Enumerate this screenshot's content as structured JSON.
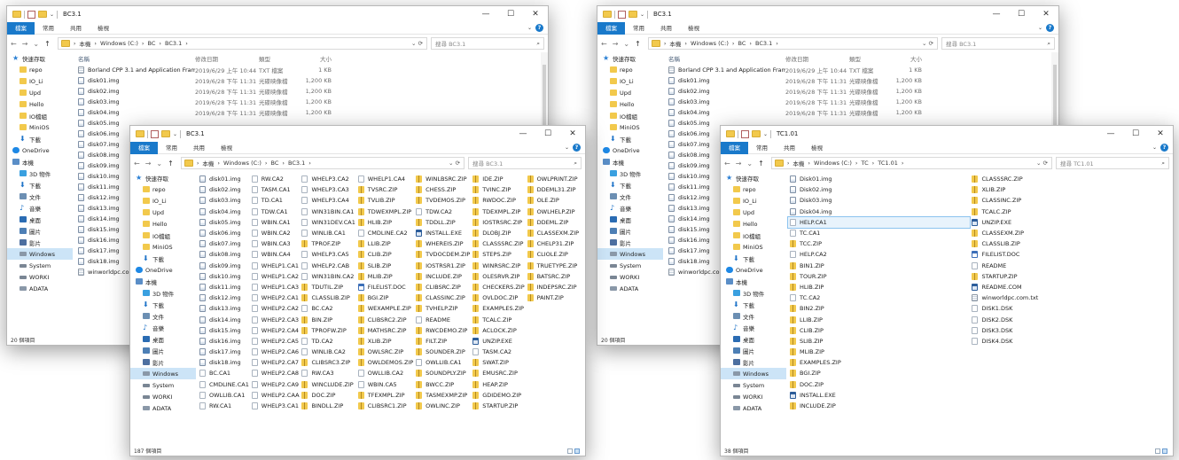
{
  "ui": {
    "tabs": [
      "檔案",
      "常用",
      "共用",
      "檢視"
    ],
    "nav_back": "←",
    "nav_fwd": "→",
    "nav_recent": "⌄",
    "nav_up": "↑",
    "minimize": "—",
    "maximize": "☐",
    "close": "✕",
    "refresh": "⟳",
    "dropdown": "⌄",
    "search_icon": "⌕",
    "help": "?",
    "ribbon_toggle": "⌄",
    "addr_sep": "›"
  },
  "nav_tree_full": [
    {
      "label": "快速存取",
      "icon": "star-icon",
      "indent": false
    },
    {
      "label": "repo",
      "icon": "folder-icon",
      "indent": true
    },
    {
      "label": "IO_Li",
      "icon": "folder-icon",
      "indent": true
    },
    {
      "label": "Upd",
      "icon": "folder-icon",
      "indent": true
    },
    {
      "label": "Hello",
      "icon": "folder-icon",
      "indent": true
    },
    {
      "label": "IO檔組",
      "icon": "folder-icon",
      "indent": true
    },
    {
      "label": "MiniOS",
      "icon": "folder-icon",
      "indent": true
    },
    {
      "label": "下載",
      "icon": "download-icon",
      "indent": true
    },
    {
      "label": "OneDrive",
      "icon": "cloud-icon",
      "indent": false
    },
    {
      "label": "本機",
      "icon": "pc-icon",
      "indent": false
    },
    {
      "label": "3D 物件",
      "icon": "objects-icon",
      "indent": true
    },
    {
      "label": "下載",
      "icon": "download-icon",
      "indent": true
    },
    {
      "label": "文件",
      "icon": "documents-icon",
      "indent": true
    },
    {
      "label": "音樂",
      "icon": "music-icon",
      "indent": true
    },
    {
      "label": "桌面",
      "icon": "desktop-icon",
      "indent": true
    },
    {
      "label": "圖片",
      "icon": "pictures-icon",
      "indent": true
    },
    {
      "label": "影片",
      "icon": "videos-icon",
      "indent": true
    },
    {
      "label": "Windows",
      "icon": "drive-icon",
      "indent": true,
      "selected": true
    },
    {
      "label": "System",
      "icon": "system-drive-icon",
      "indent": true
    },
    {
      "label": "WORKI",
      "icon": "system-drive-icon",
      "indent": true
    },
    {
      "label": "ADATA",
      "icon": "drive-icon",
      "indent": true
    }
  ],
  "headers": {
    "name": "名稱",
    "date": "修改日期",
    "type": "類型",
    "size": "大小"
  },
  "win1": {
    "title": "BC3.1",
    "address": [
      "本機",
      "Windows (C:)",
      "BC",
      "BC3.1"
    ],
    "search": "搜尋 BC3.1",
    "status": "20 個項目",
    "rows": [
      {
        "name": "Borland CPP 3.1 and Application Fram...",
        "date": "2019/6/29 上午 10:44",
        "type": "TXT 檔案",
        "size": "1 KB",
        "icon": "txt"
      },
      {
        "name": "disk01.img",
        "date": "2019/6/28 下午 11:31",
        "type": "光碟映像檔",
        "size": "1,200 KB",
        "icon": "img"
      },
      {
        "name": "disk02.img",
        "date": "2019/6/28 下午 11:31",
        "type": "光碟映像檔",
        "size": "1,200 KB",
        "icon": "img"
      },
      {
        "name": "disk03.img",
        "date": "2019/6/28 下午 11:31",
        "type": "光碟映像檔",
        "size": "1,200 KB",
        "icon": "img"
      },
      {
        "name": "disk04.img",
        "date": "2019/6/28 下午 11:31",
        "type": "光碟映像檔",
        "size": "1,200 KB",
        "icon": "img"
      },
      {
        "name": "disk05.img",
        "icon": "img"
      },
      {
        "name": "disk06.img",
        "icon": "img"
      },
      {
        "name": "disk07.img",
        "icon": "img"
      },
      {
        "name": "disk08.img",
        "icon": "img"
      },
      {
        "name": "disk09.img",
        "icon": "img"
      },
      {
        "name": "disk10.img",
        "icon": "img"
      },
      {
        "name": "disk11.img",
        "icon": "img"
      },
      {
        "name": "disk12.img",
        "icon": "img"
      },
      {
        "name": "disk13.img",
        "icon": "img"
      },
      {
        "name": "disk14.img",
        "icon": "img"
      },
      {
        "name": "disk15.img",
        "icon": "img"
      },
      {
        "name": "disk16.img",
        "icon": "img"
      },
      {
        "name": "disk17.img",
        "icon": "img"
      },
      {
        "name": "disk18.img",
        "icon": "img"
      },
      {
        "name": "winworldpc.com",
        "icon": "txt"
      }
    ]
  },
  "win2": {
    "title": "BC3.1",
    "address": [
      "本機",
      "Windows (C:)",
      "BC",
      "BC3.1"
    ],
    "search": "搜尋 BC3.1",
    "status": "187 個項目",
    "files": [
      "disk01.img",
      "disk02.img",
      "disk03.img",
      "disk04.img",
      "disk05.img",
      "disk06.img",
      "disk07.img",
      "disk08.img",
      "disk09.img",
      "disk10.img",
      "disk11.img",
      "disk12.img",
      "disk13.img",
      "disk14.img",
      "disk15.img",
      "disk16.img",
      "disk17.img",
      "disk18.img",
      "BC.CA1",
      "CMDLINE.CA1",
      "OWLLIB.CA1",
      "RW.CA1",
      "RW.CA2",
      "TASM.CA1",
      "TD.CA1",
      "TDW.CA1",
      "WBIN.CA1",
      "WBIN.CA2",
      "WBIN.CA3",
      "WBIN.CA4",
      "WHELP1.CA1",
      "WHELP1.CA2",
      "WHELP1.CA3",
      "WHELP2.CA1",
      "WHELP2.CA2",
      "WHELP2.CA3",
      "WHELP2.CA4",
      "WHELP2.CA5",
      "WHELP2.CA6",
      "WHELP2.CA7",
      "WHELP2.CA8",
      "WHELP2.CA9",
      "WHELP2.CAA",
      "WHELP3.CA1",
      "WHELP3.CA2",
      "WHELP3.CA3",
      "WHELP3.CA4",
      "WIN31BIN.CA1",
      "WIN31DEV.CA1",
      "WINLIB.CA1",
      "TPROF.ZIP",
      "WHELP3.CA5",
      "WHELP2.CAB",
      "WIN31BIN.CA2",
      "TDUTIL.ZIP",
      "CLASSLIB.ZIP",
      "BC.CA2",
      "BIN.ZIP",
      "TPROFW.ZIP",
      "TD.CA2",
      "WINLIB.CA2",
      "CLIBSRC3.ZIP",
      "RW.CA3",
      "WINCLUDE.ZIP",
      "DOC.ZIP",
      "BINDLL.ZIP",
      "WHELP1.CA4",
      "TVSRC.ZIP",
      "TVLIB.ZIP",
      "TDWEXMPL.ZIP",
      "HLIB.ZIP",
      "CMDLINE.CA2",
      "LLIB.ZIP",
      "CLIB.ZIP",
      "SLIB.ZIP",
      "MLIB.ZIP",
      "FILELIST.DOC",
      "BGI.ZIP",
      "WEXAMPLE.ZIP",
      "CLIBSRC2.ZIP",
      "MATHSRC.ZIP",
      "XLIB.ZIP",
      "OWLSRC.ZIP",
      "OWLDEMOS.ZIP",
      "OWLLIB.CA2",
      "WBIN.CA5",
      "TFEXMPL.ZIP",
      "CLIBSRC1.ZIP",
      "WINLBSRC.ZIP",
      "CHESS.ZIP",
      "TVDEMOS.ZIP",
      "TDW.CA2",
      "TDDLL.ZIP",
      "INSTALL.EXE",
      "WHEREIS.ZIP",
      "TVDOCDEM.ZIP",
      "IOSTRSR1.ZIP",
      "INCLUDE.ZIP",
      "CLIBSRC.ZIP",
      "CLASSINC.ZIP",
      "TVHELP.ZIP",
      "README",
      "RWCDEMO.ZIP",
      "FILT.ZIP",
      "SOUNDER.ZIP",
      "OWLLIB.CA1",
      "SOUNDPLY.ZIP",
      "BWCC.ZIP",
      "TASMEXMP.ZIP",
      "OWLINC.ZIP",
      "IDE.ZIP",
      "TVINC.ZIP",
      "RWDOC.ZIP",
      "TDEXMPL.ZIP",
      "IOSTRSRC.ZIP",
      "DLOBJ.ZIP",
      "CLASSSRC.ZIP",
      "STEPS.ZIP",
      "WINRSRC.ZIP",
      "OLESRVR.ZIP",
      "CHECKERS.ZIP",
      "OVLDOC.ZIP",
      "EXAMPLES.ZIP",
      "TCALC.ZIP",
      "ACLOCK.ZIP",
      "UNZIP.EXE",
      "TASM.CA2",
      "SWAT.ZIP",
      "EMUSRC.ZIP",
      "HEAP.ZIP",
      "GDIDEMO.ZIP",
      "STARTUP.ZIP",
      "OWLPRINT.ZIP",
      "DDEML31.ZIP",
      "OLE.ZIP",
      "OWLHELP.ZIP",
      "DDEML.ZIP",
      "CLASSEXM.ZIP",
      "CHELP31.ZIP",
      "CLIOLE.ZIP",
      "TRUETYPE.ZIP",
      "BATSRC.ZIP",
      "INDEPSRC.ZIP",
      "PAINT.ZIP"
    ]
  },
  "win3": {
    "title": "BC3.1",
    "address": [
      "本機",
      "Windows (C:)",
      "BC",
      "BC3.1"
    ],
    "search": "搜尋 BC3.1",
    "status": "20 個項目",
    "rows": [
      {
        "name": "Borland CPP 3.1 and Application Fram...",
        "date": "2019/6/29 上午 10:44",
        "type": "TXT 檔案",
        "size": "1 KB",
        "icon": "txt"
      },
      {
        "name": "disk01.img",
        "date": "2019/6/28 下午 11:31",
        "type": "光碟映像檔",
        "size": "1,200 KB",
        "icon": "img"
      },
      {
        "name": "disk02.img",
        "date": "2019/6/28 下午 11:31",
        "type": "光碟映像檔",
        "size": "1,200 KB",
        "icon": "img"
      },
      {
        "name": "disk03.img",
        "date": "2019/6/28 下午 11:31",
        "type": "光碟映像檔",
        "size": "1,200 KB",
        "icon": "img"
      },
      {
        "name": "disk04.img",
        "date": "2019/6/28 下午 11:31",
        "type": "光碟映像檔",
        "size": "1,200 KB",
        "icon": "img"
      },
      {
        "name": "disk05.img",
        "icon": "img"
      },
      {
        "name": "disk06.img",
        "icon": "img"
      },
      {
        "name": "disk07.img",
        "icon": "img"
      },
      {
        "name": "disk08.img",
        "icon": "img"
      },
      {
        "name": "disk09.img",
        "icon": "img"
      },
      {
        "name": "disk10.img",
        "icon": "img"
      },
      {
        "name": "disk11.img",
        "icon": "img"
      },
      {
        "name": "disk12.img",
        "icon": "img"
      },
      {
        "name": "disk13.img",
        "icon": "img"
      },
      {
        "name": "disk14.img",
        "icon": "img"
      },
      {
        "name": "disk15.img",
        "icon": "img"
      },
      {
        "name": "disk16.img",
        "icon": "img"
      },
      {
        "name": "disk17.img",
        "icon": "img"
      },
      {
        "name": "disk18.img",
        "icon": "img"
      },
      {
        "name": "winworldpc.com",
        "icon": "txt"
      }
    ]
  },
  "win4": {
    "title": "TC1.01",
    "address": [
      "本機",
      "Windows (C:)",
      "TC",
      "TC1.01"
    ],
    "search": "搜尋 TC1.01",
    "status": "38 個項目",
    "highlighted": "HELP.CA1",
    "files": [
      "Disk01.img",
      "Disk02.img",
      "Disk03.img",
      "Disk04.img",
      "HELP.CA1",
      "TC.CA1",
      "TCC.ZIP",
      "HELP.CA2",
      "BIN1.ZIP",
      "TOUR.ZIP",
      "HLIB.ZIP",
      "TC.CA2",
      "BIN2.ZIP",
      "LLIB.ZIP",
      "CLIB.ZIP",
      "SLIB.ZIP",
      "MLIB.ZIP",
      "EXAMPLES.ZIP",
      "BGI.ZIP",
      "DOC.ZIP",
      "INSTALL.EXE",
      "INCLUDE.ZIP",
      "CLASSSRC.ZIP",
      "XLIB.ZIP",
      "CLASSINC.ZIP",
      "TCALC.ZIP",
      "UNZIP.EXE",
      "CLASSEXM.ZIP",
      "CLASSLIB.ZIP",
      "FILELIST.DOC",
      "README",
      "STARTUP.ZIP",
      "README.COM",
      "winworldpc.com.txt",
      "DISK1.DSK",
      "DISK2.DSK",
      "DISK3.DSK",
      "DISK4.DSK"
    ]
  }
}
